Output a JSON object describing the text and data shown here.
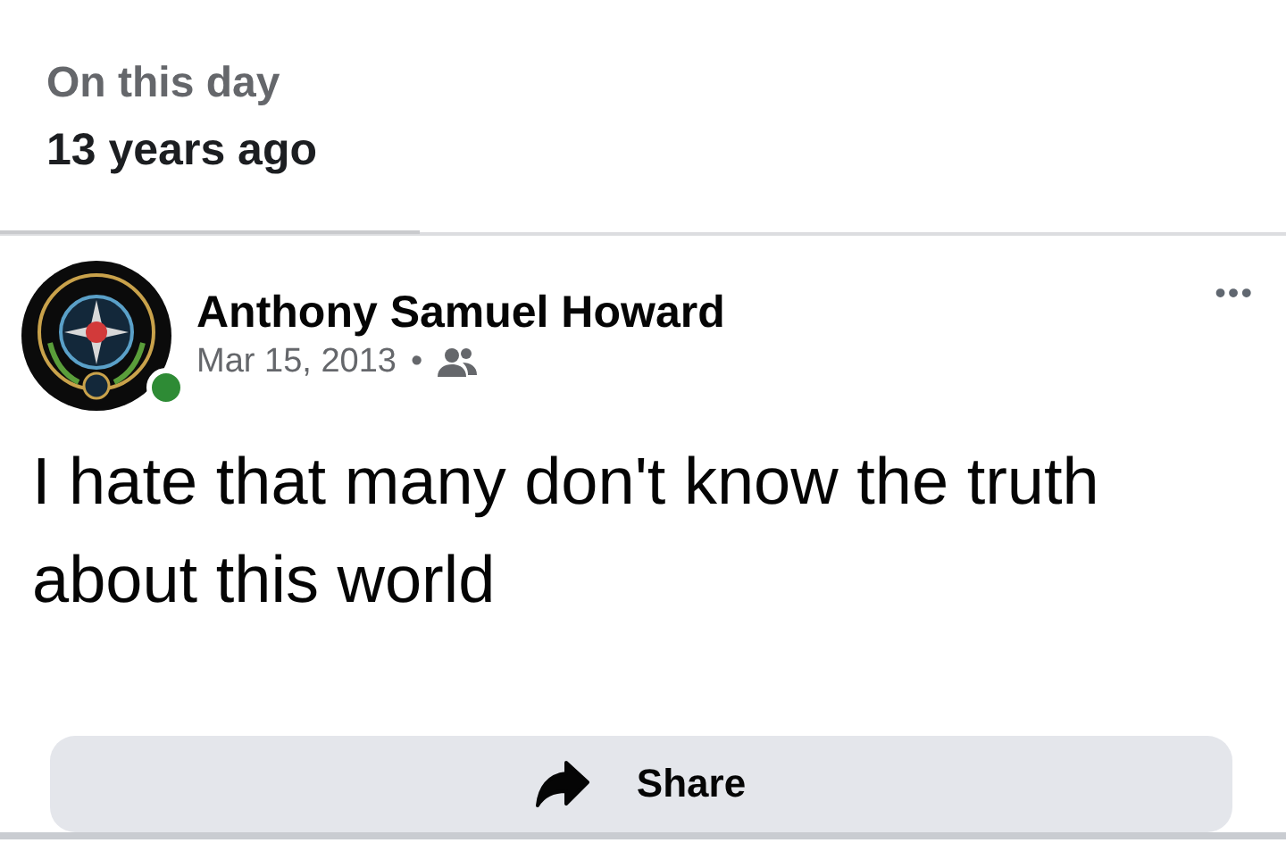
{
  "memory_header": {
    "title": "On this day",
    "subtitle": "13 years ago"
  },
  "post": {
    "author": "Anthony Samuel Howard",
    "online": true,
    "date": "Mar 15, 2013",
    "separator": "•",
    "audience": {
      "kind": "friends"
    },
    "more": "•••",
    "text": "I hate that many don't know the truth about this world"
  },
  "actions": [
    {
      "label": "Share",
      "kind": "share"
    }
  ]
}
